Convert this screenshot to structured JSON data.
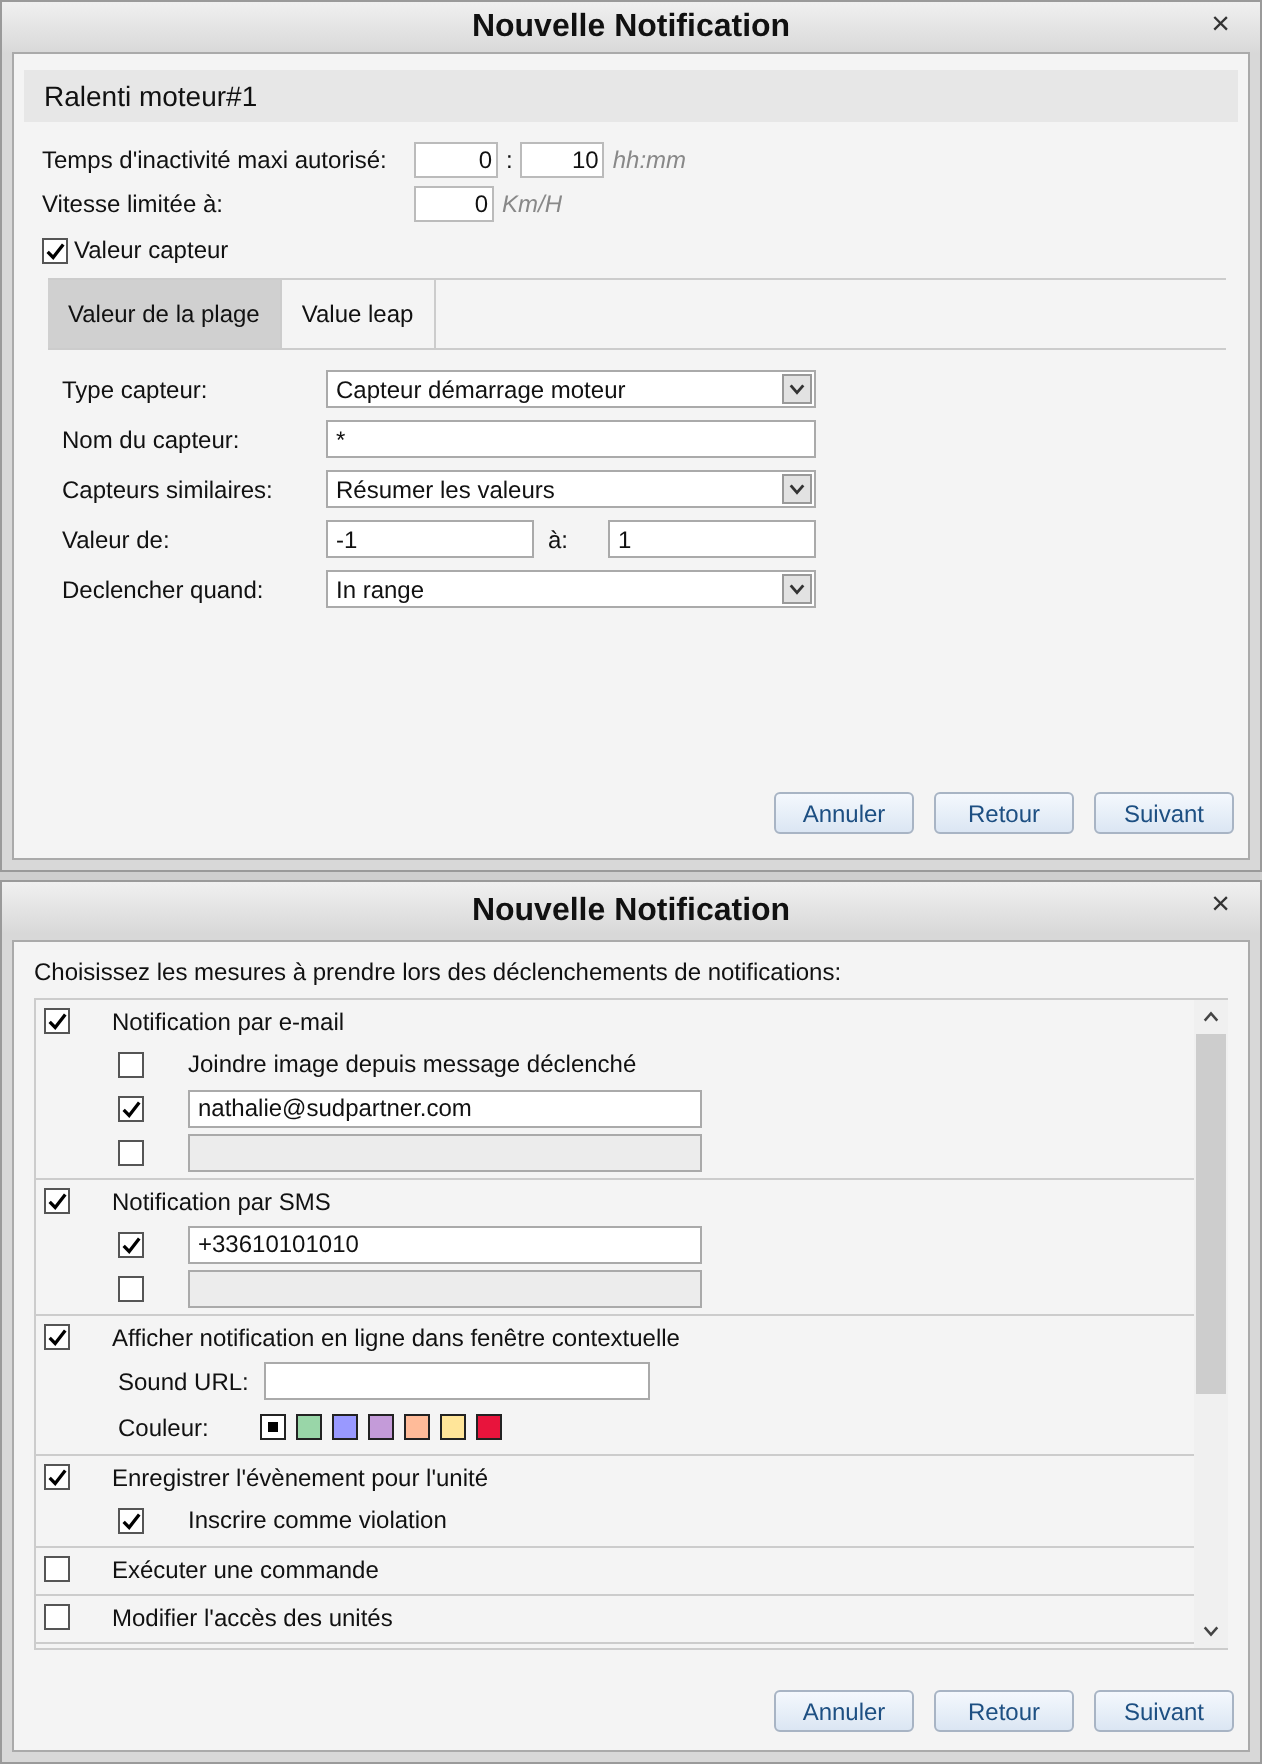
{
  "sensor_dialog": {
    "title": "Nouvelle Notification",
    "close": "×",
    "header": "Ralenti moteur#1",
    "idle_time": {
      "label": "Temps d'inactivité maxi autorisé:",
      "hours": "0",
      "separator": ":",
      "minutes": "10",
      "unit": "hh:mm"
    },
    "speed": {
      "label": "Vitesse limitée à:",
      "value": "0",
      "unit": "Km/H"
    },
    "sensor_value": {
      "label": "Valeur capteur",
      "checked": true
    },
    "tabs": [
      {
        "label": "Valeur de la plage",
        "selected": true
      },
      {
        "label": "Value leap",
        "selected": false
      }
    ],
    "form": [
      {
        "kind": "select",
        "label": "Type capteur:",
        "value": "Capteur démarrage moteur"
      },
      {
        "kind": "text",
        "label": "Nom du capteur:",
        "value": "*"
      },
      {
        "kind": "select",
        "label": "Capteurs similaires:",
        "value": "Résumer les valeurs"
      },
      {
        "kind": "range",
        "label": "Valeur de:",
        "from": "-1",
        "to_label": "à:",
        "to": "1"
      },
      {
        "kind": "select",
        "label": "Declencher quand:",
        "value": "In range"
      }
    ],
    "buttons": [
      "Annuler",
      "Retour",
      "Suivant"
    ]
  },
  "actions_dialog": {
    "title": "Nouvelle Notification",
    "close": "×",
    "instruction": "Choisissez les mesures à prendre lors des déclenchements de notifications:",
    "sections": [
      {
        "label": "Notification par e-mail",
        "checked": true,
        "items": [
          {
            "kind": "check",
            "label": "Joindre image depuis message déclenché",
            "checked": false
          },
          {
            "kind": "check-field",
            "checked": true,
            "value": "nathalie@sudpartner.com",
            "disabled": false
          },
          {
            "kind": "check-field",
            "checked": false,
            "disabled": true
          }
        ]
      },
      {
        "label": "Notification par SMS",
        "checked": true,
        "items": [
          {
            "kind": "check-field",
            "checked": true,
            "value": "+33610101010",
            "disabled": false
          },
          {
            "kind": "check-field",
            "checked": false,
            "disabled": true
          }
        ]
      },
      {
        "label": "Afficher notification en ligne dans fenêtre contextuelle",
        "checked": true,
        "items": [
          {
            "kind": "field",
            "label": "Sound URL:"
          },
          {
            "kind": "colors",
            "label": "Couleur:",
            "swatches": [
              {
                "color": "#000000",
                "selected": true
              },
              {
                "color": "#99d6a8",
                "selected": false
              },
              {
                "color": "#9999ff",
                "selected": false
              },
              {
                "color": "#c49bd9",
                "selected": false
              },
              {
                "color": "#ffbb99",
                "selected": false
              },
              {
                "color": "#ffe599",
                "selected": false
              },
              {
                "color": "#e8143c",
                "selected": false
              }
            ]
          }
        ]
      },
      {
        "label": "Enregistrer l'évènement pour l'unité",
        "checked": true,
        "items": [
          {
            "kind": "check",
            "label": "Inscrire comme violation",
            "checked": true
          }
        ]
      },
      {
        "label": "Exécuter une commande",
        "checked": false
      },
      {
        "label": "Modifier l'accès des unités",
        "checked": false
      }
    ],
    "buttons": [
      "Annuler",
      "Retour",
      "Suivant"
    ]
  }
}
